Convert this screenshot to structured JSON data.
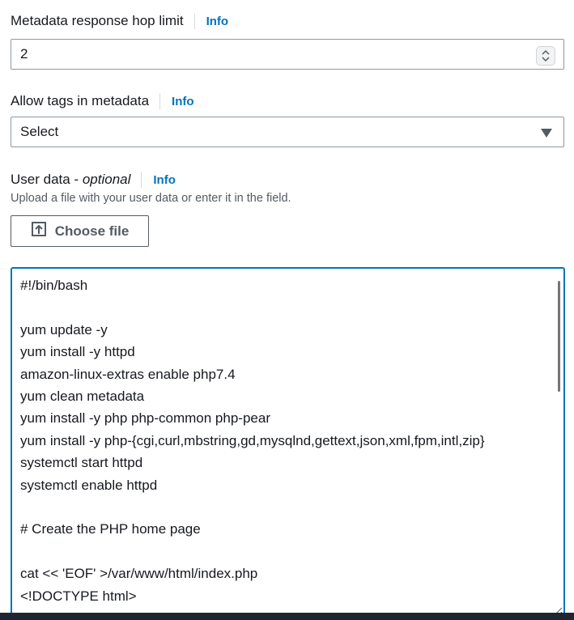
{
  "hop_limit": {
    "label": "Metadata response hop limit",
    "info": "Info",
    "value": "2"
  },
  "tags_in_metadata": {
    "label": "Allow tags in metadata",
    "info": "Info",
    "selected": "Select"
  },
  "user_data": {
    "label": "User data -",
    "optional": "optional",
    "info": "Info",
    "description": "Upload a file with your user data or enter it in the field.",
    "choose_file_label": "Choose file",
    "content": "#!/bin/bash\n\nyum update -y\nyum install -y httpd\namazon-linux-extras enable php7.4\nyum clean metadata\nyum install -y php php-common php-pear\nyum install -y php-{cgi,curl,mbstring,gd,mysqlnd,gettext,json,xml,fpm,intl,zip}\nsystemctl start httpd\nsystemctl enable httpd\n\n# Create the PHP home page\n\ncat << 'EOF' >/var/www/html/index.php\n<!DOCTYPE html>"
  },
  "colors": {
    "link": "#0073bb",
    "focus_border": "#0073bb",
    "text": "#16191f",
    "muted": "#545b64"
  },
  "icons": [
    "stepper-icon",
    "dropdown-caret-icon",
    "upload-icon",
    "resize-grip-icon"
  ]
}
